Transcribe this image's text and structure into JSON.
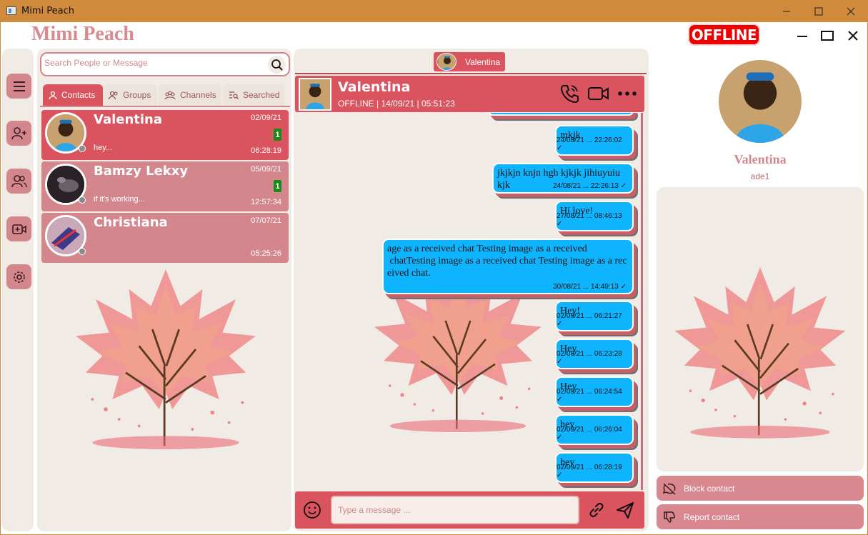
{
  "window": {
    "title": "Mimi Peach"
  },
  "header": {
    "brand": "Mimi Peach",
    "status_badge": "OFFLINE"
  },
  "search": {
    "placeholder": "Search People or Message"
  },
  "tabs": [
    {
      "label": "Contacts",
      "icon": "person-icon",
      "active": true
    },
    {
      "label": "Groups",
      "icon": "people-icon"
    },
    {
      "label": "Channels",
      "icon": "people-group-icon"
    },
    {
      "label": "Searched",
      "icon": "search-list-icon"
    }
  ],
  "contacts": [
    {
      "name": "Valentina",
      "date": "02/09/21",
      "unread": "1",
      "message": "hey...",
      "time": "06:28:19",
      "selected": true
    },
    {
      "name": "Bamzy Lekxy",
      "date": "05/09/21",
      "unread": "1",
      "message": " if it's working...",
      "time": "12:57:34"
    },
    {
      "name": "Christiana",
      "date": "07/07/21",
      "unread": "",
      "message": "",
      "time": "05:25:26"
    }
  ],
  "chat": {
    "tab_label": "Valentina",
    "name": "Valentina",
    "status": "OFFLINE | 14/09/21 | 05:51:23",
    "messages": [
      {
        "text": "mkjk",
        "meta": "24/08/21 ... 22:26:02 ✓"
      },
      {
        "text": "jkjkjn knjn hgh kjkjk jihiuyuiu kjk",
        "meta": "24/08/21 ... 22:26:13 ✓"
      },
      {
        "text": "Hi love!",
        "meta": "27/08/21 ... 08:46:13 ✓"
      },
      {
        "line1": "age as a received chat Testing image as a received",
        "line2": " chatTesting image as a received chat Testing image as a rec",
        "line3": "eived chat.",
        "meta": "30/08/21 ... 14:49:13 ✓"
      },
      {
        "text": "Hey!",
        "meta": "02/09/21 ... 06:21:27 ✓"
      },
      {
        "text": "Hey",
        "meta": "02/09/21 ... 06:23:28 ✓"
      },
      {
        "text": "Hey",
        "meta": "02/09/21 ... 06:24:54 ✓"
      },
      {
        "text": "hey",
        "meta": "02/09/21 ... 06:26:04 ✓"
      },
      {
        "text": "hey",
        "meta": "02/09/21 ... 06:28:19 ✓"
      }
    ],
    "composer_placeholder": "Type a message ..."
  },
  "profile": {
    "name": "Valentina",
    "username": "ade1",
    "actions": {
      "block": "Block contact",
      "report": "Report contact"
    }
  },
  "colors": {
    "accent": "#d9545e",
    "accent_soft": "#d4868d",
    "bubble": "#0fb4ff",
    "panel": "#f1ebe6",
    "titlebar": "#d08a3c",
    "offline": "#ee0000",
    "unread": "#1a8b1a"
  }
}
